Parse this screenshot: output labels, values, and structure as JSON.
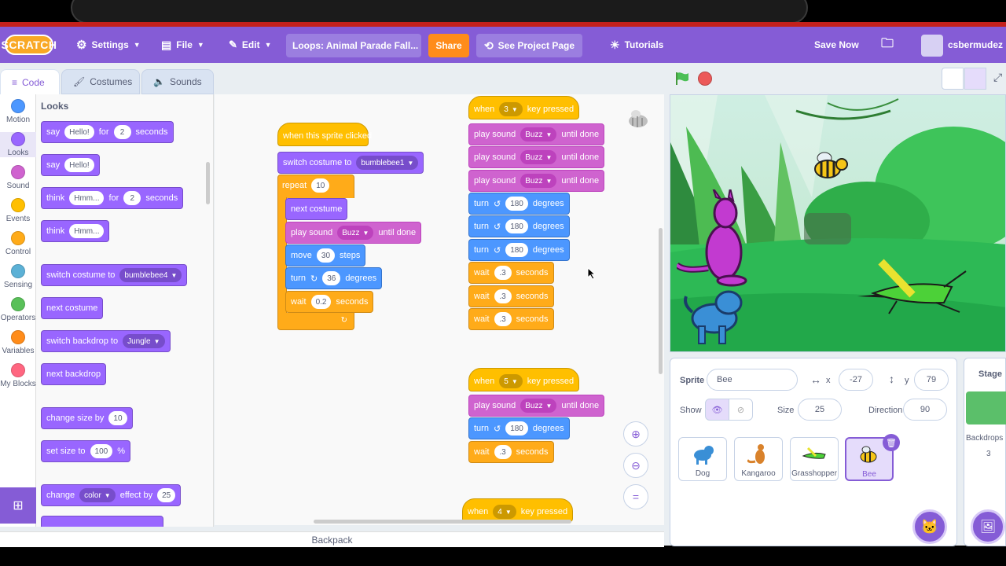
{
  "menubar": {
    "logo": "SCRATCH",
    "settings": "Settings",
    "file": "File",
    "edit": "Edit",
    "project_title": "Loops: Animal Parade Fall...",
    "share": "Share",
    "see_project": "See Project Page",
    "tutorials": "Tutorials",
    "save_now": "Save Now",
    "username": "csbermudez"
  },
  "tabs": {
    "code": "Code",
    "costumes": "Costumes",
    "sounds": "Sounds"
  },
  "categories": [
    {
      "label": "Motion",
      "color": "#4c97ff"
    },
    {
      "label": "Looks",
      "color": "#9966ff"
    },
    {
      "label": "Sound",
      "color": "#cf63cf"
    },
    {
      "label": "Events",
      "color": "#ffbf00"
    },
    {
      "label": "Control",
      "color": "#ffab19"
    },
    {
      "label": "Sensing",
      "color": "#5cb1d6"
    },
    {
      "label": "Operators",
      "color": "#59c059"
    },
    {
      "label": "Variables",
      "color": "#ff8c1a"
    },
    {
      "label": "My Blocks",
      "color": "#ff6680"
    }
  ],
  "palette": {
    "heading": "Looks",
    "say_for": {
      "say": "say",
      "msg": "Hello!",
      "for": "for",
      "secs": "2",
      "seconds": "seconds"
    },
    "say": {
      "say": "say",
      "msg": "Hello!"
    },
    "think_for": {
      "think": "think",
      "msg": "Hmm...",
      "for": "for",
      "secs": "2",
      "seconds": "seconds"
    },
    "think": {
      "think": "think",
      "msg": "Hmm..."
    },
    "switch_costume": {
      "label": "switch costume to",
      "value": "bumblebee4"
    },
    "next_costume": "next costume",
    "switch_backdrop": {
      "label": "switch backdrop to",
      "value": "Jungle"
    },
    "next_backdrop": "next backdrop",
    "change_size": {
      "label": "change size by",
      "value": "10"
    },
    "set_size": {
      "label": "set size to",
      "value": "100",
      "unit": "%"
    },
    "change_effect": {
      "change": "change",
      "effect": "color",
      "by": "effect by",
      "value": "25"
    }
  },
  "script1": {
    "hat": "when this sprite clicked",
    "switch": "switch costume to",
    "switch_val": "bumblebee1",
    "repeat": "repeat",
    "repeat_val": "10",
    "next": "next costume",
    "play": "play sound",
    "sound": "Buzz",
    "until": "until done",
    "move": "move",
    "move_val": "30",
    "steps": "steps",
    "turn": "turn",
    "turn_val": "36",
    "degrees": "degrees",
    "wait": "wait",
    "wait_val": "0.2",
    "seconds": "seconds"
  },
  "script2": {
    "when": "when",
    "key": "3",
    "pressed": "key pressed",
    "play": "play sound",
    "sound": "Buzz",
    "until": "until done",
    "turn": "turn",
    "turn_val": "180",
    "degrees": "degrees",
    "wait": "wait",
    "wait_val": ".3",
    "seconds": "seconds"
  },
  "script3": {
    "when": "when",
    "key": "5",
    "pressed": "key pressed",
    "play": "play sound",
    "sound": "Buzz",
    "until": "until done",
    "turn": "turn",
    "turn_val": "180",
    "degrees": "degrees",
    "wait": "wait",
    "wait_val": ".3",
    "seconds": "seconds"
  },
  "script4": {
    "when": "when",
    "key": "4",
    "pressed": "key pressed"
  },
  "backpack": "Backpack",
  "sprite_info": {
    "sprite_label": "Sprite",
    "sprite_name": "Bee",
    "x_label": "x",
    "x": "-27",
    "y_label": "y",
    "y": "79",
    "show_label": "Show",
    "size_label": "Size",
    "size": "25",
    "direction_label": "Direction",
    "direction": "90"
  },
  "sprites": [
    "Dog",
    "Kangaroo",
    "Grasshopper",
    "Bee"
  ],
  "stage_pane": {
    "title": "Stage",
    "backdrops_label": "Backdrops",
    "backdrops_count": "3"
  }
}
